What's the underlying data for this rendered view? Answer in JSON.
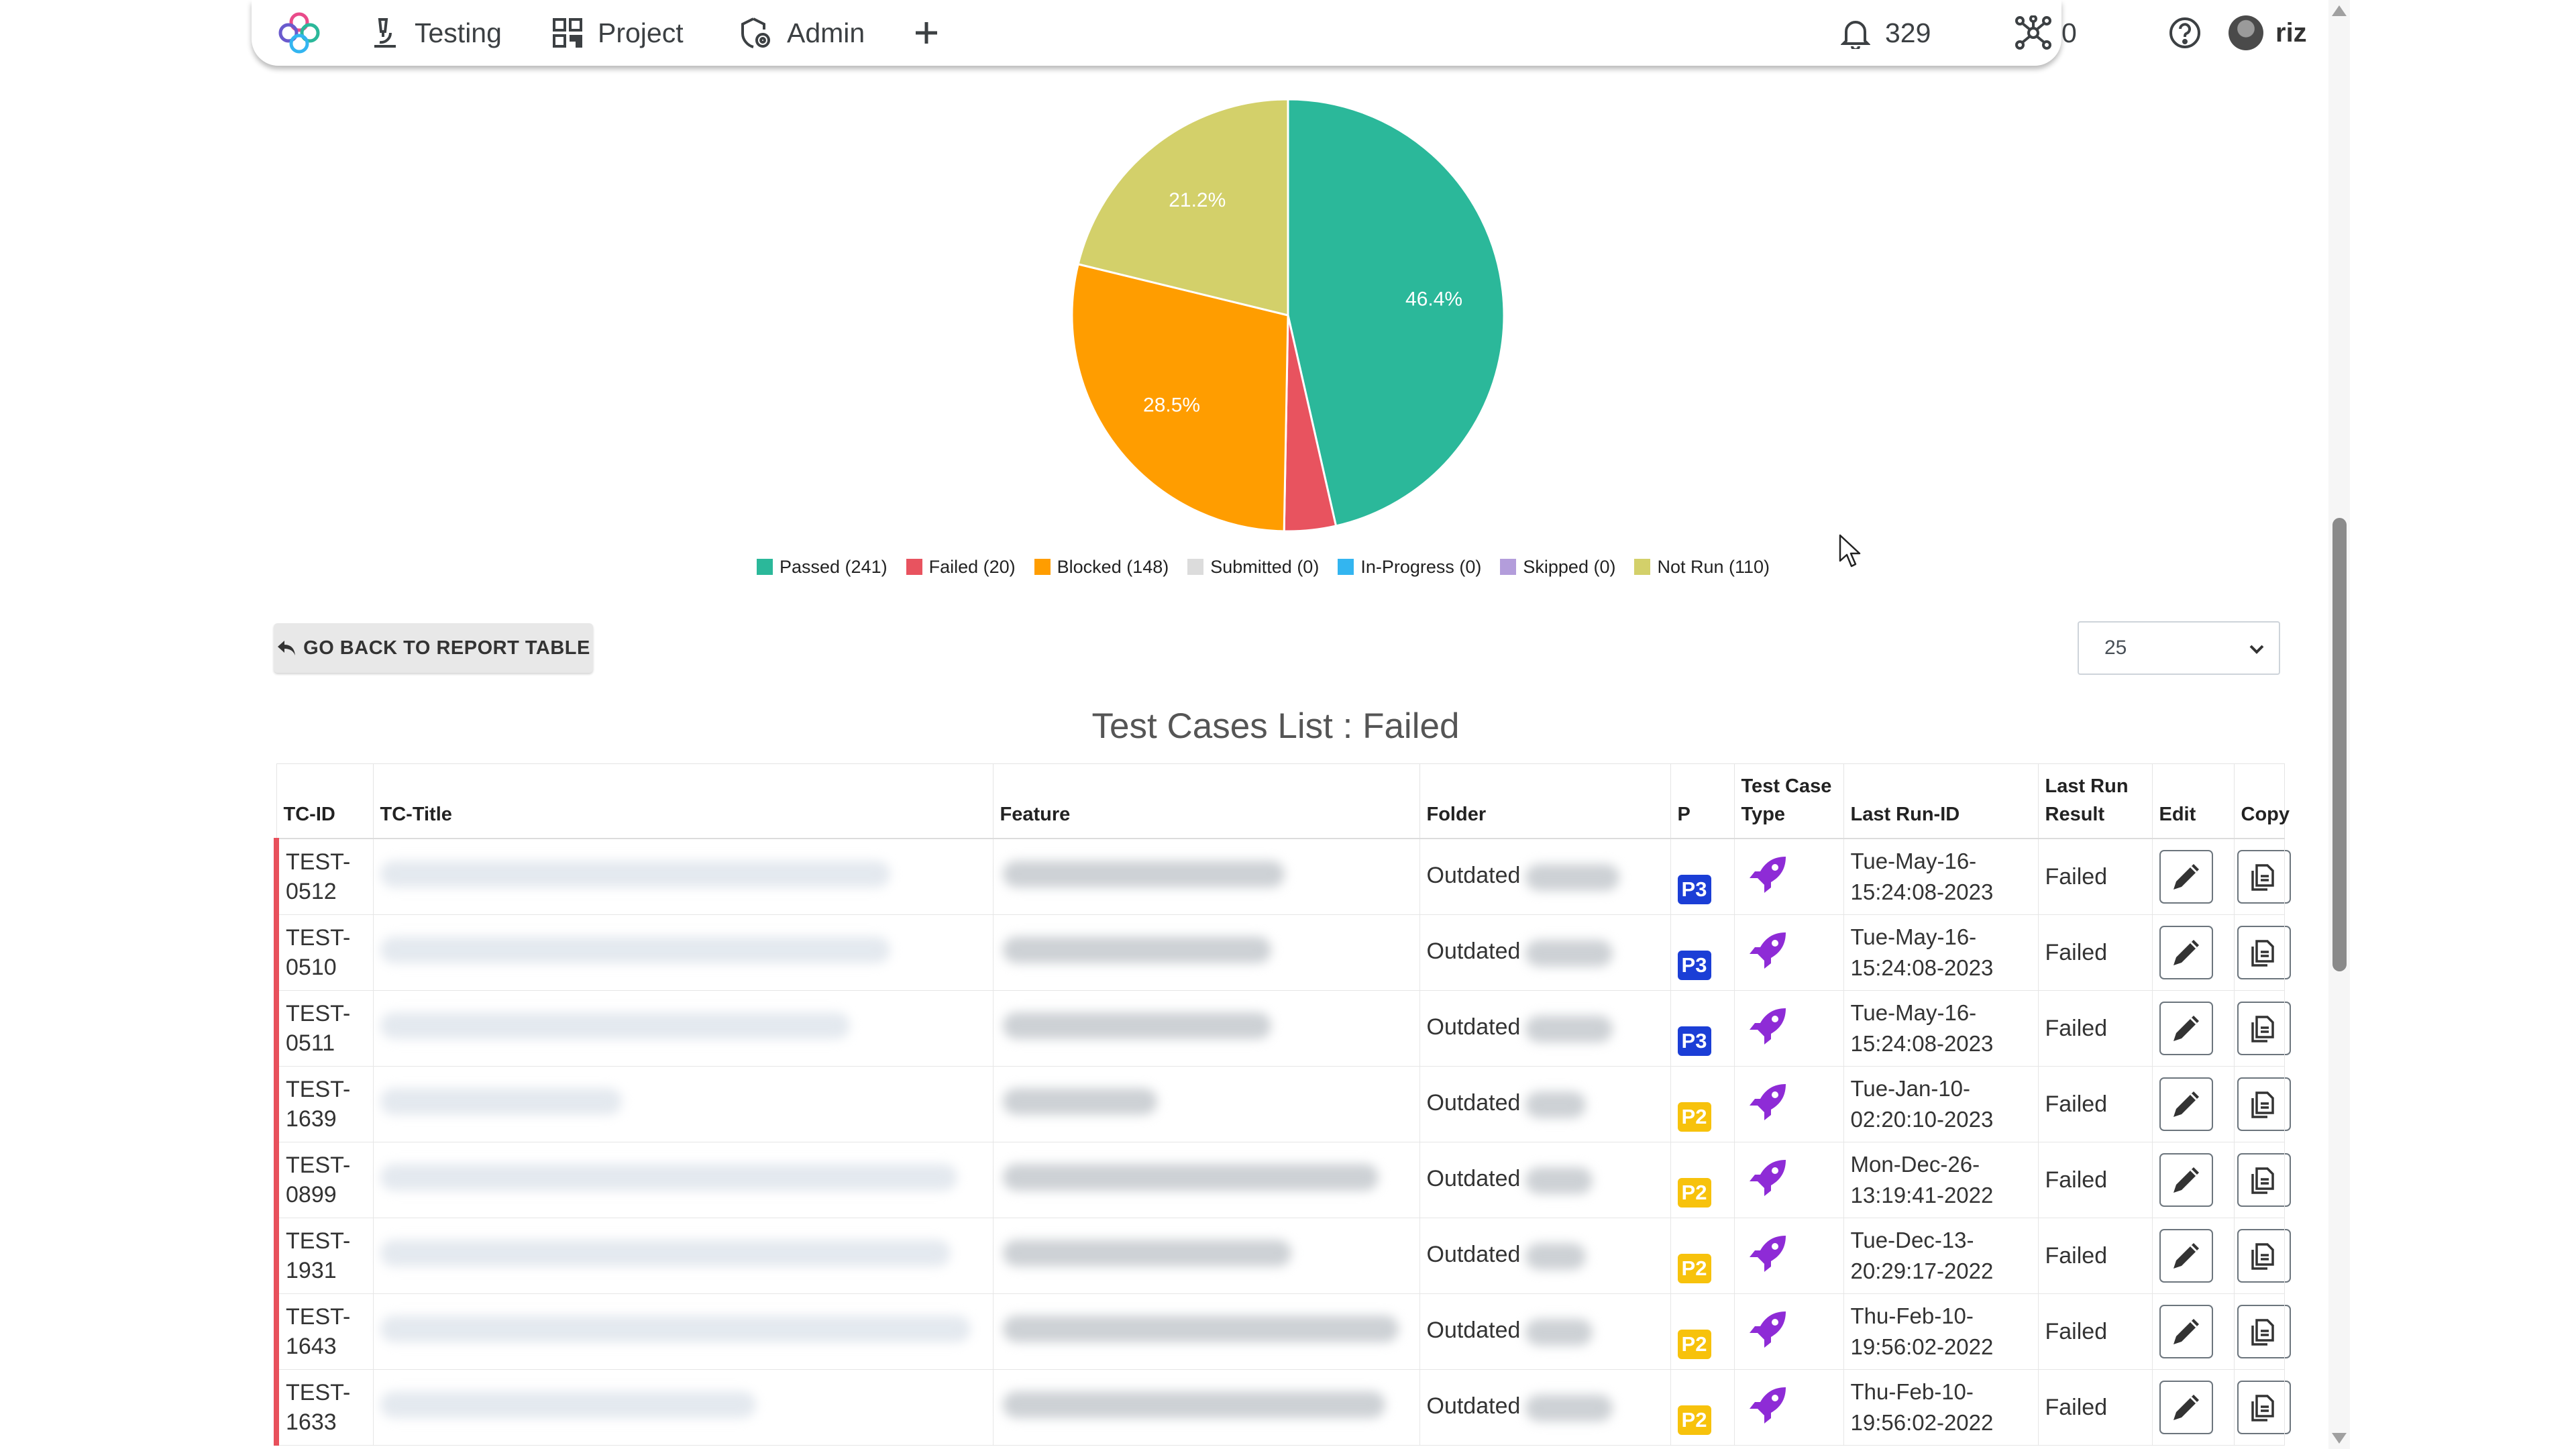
{
  "nav": {
    "testing": "Testing",
    "project": "Project",
    "admin": "Admin",
    "notifications_count": "329",
    "integrations_count": "0",
    "user": "riz"
  },
  "colors": {
    "passed": "#2bb89a",
    "failed": "#e8535f",
    "blocked": "#ff9d00",
    "submitted": "#dcdcdc",
    "in_progress": "#33b5f0",
    "skipped": "#b39ddb",
    "not_run": "#d3d06a",
    "p3": "#1b3ed6",
    "p2": "#f7c20c",
    "link": "#1a6fd8",
    "rocket": "#8e2bd6"
  },
  "chart_data": {
    "type": "pie",
    "title": "",
    "series": [
      {
        "name": "Passed",
        "label": "Passed (241)",
        "value": 241,
        "color": "#2bb89a",
        "pct_label": "46.4%"
      },
      {
        "name": "Failed",
        "label": "Failed (20)",
        "value": 20,
        "color": "#e8535f",
        "pct_label": ""
      },
      {
        "name": "Blocked",
        "label": "Blocked (148)",
        "value": 148,
        "color": "#ff9d00",
        "pct_label": "28.5%"
      },
      {
        "name": "Submitted",
        "label": "Submitted (0)",
        "value": 0,
        "color": "#dcdcdc",
        "pct_label": ""
      },
      {
        "name": "In-Progress",
        "label": "In-Progress (0)",
        "value": 0,
        "color": "#33b5f0",
        "pct_label": ""
      },
      {
        "name": "Skipped",
        "label": "Skipped (0)",
        "value": 0,
        "color": "#b39ddb",
        "pct_label": ""
      },
      {
        "name": "Not Run",
        "label": "Not Run (110)",
        "value": 110,
        "color": "#d3d06a",
        "pct_label": "21.2%"
      }
    ],
    "legend_position": "bottom"
  },
  "controls": {
    "back_label": "GO BACK TO REPORT TABLE",
    "page_size": "25"
  },
  "list_title": "Test Cases List : Failed",
  "table": {
    "headers": {
      "id": "TC-ID",
      "title": "TC-Title",
      "feature": "Feature",
      "folder": "Folder",
      "priority": "P",
      "type_line1": "Test Case",
      "type_line2": "Type",
      "run_id": "Last Run-ID",
      "result_line1": "Last Run",
      "result_line2": "Result",
      "edit": "Edit",
      "copy": "Copy"
    },
    "rows": [
      {
        "id1": "TEST-",
        "id2": "0512",
        "folder": "Outdated",
        "priority": "P3",
        "run1": "Tue-May-16-",
        "run2": "15:24:08-2023",
        "result": "Failed"
      },
      {
        "id1": "TEST-",
        "id2": "0510",
        "folder": "Outdated",
        "priority": "P3",
        "run1": "Tue-May-16-",
        "run2": "15:24:08-2023",
        "result": "Failed"
      },
      {
        "id1": "TEST-",
        "id2": "0511",
        "folder": "Outdated",
        "priority": "P3",
        "run1": "Tue-May-16-",
        "run2": "15:24:08-2023",
        "result": "Failed"
      },
      {
        "id1": "TEST-",
        "id2": "1639",
        "folder": "Outdated",
        "priority": "P2",
        "run1": "Tue-Jan-10-",
        "run2": "02:20:10-2023",
        "result": "Failed"
      },
      {
        "id1": "TEST-",
        "id2": "0899",
        "folder": "Outdated",
        "priority": "P2",
        "run1": "Mon-Dec-26-",
        "run2": "13:19:41-2022",
        "result": "Failed"
      },
      {
        "id1": "TEST-",
        "id2": "1931",
        "folder": "Outdated",
        "priority": "P2",
        "run1": "Tue-Dec-13-",
        "run2": "20:29:17-2022",
        "result": "Failed"
      },
      {
        "id1": "TEST-",
        "id2": "1643",
        "folder": "Outdated",
        "priority": "P2",
        "run1": "Thu-Feb-10-",
        "run2": "19:56:02-2022",
        "result": "Failed"
      },
      {
        "id1": "TEST-",
        "id2": "1633",
        "folder": "Outdated",
        "priority": "P2",
        "run1": "Thu-Feb-10-",
        "run2": "19:56:02-2022",
        "result": "Failed"
      }
    ]
  }
}
